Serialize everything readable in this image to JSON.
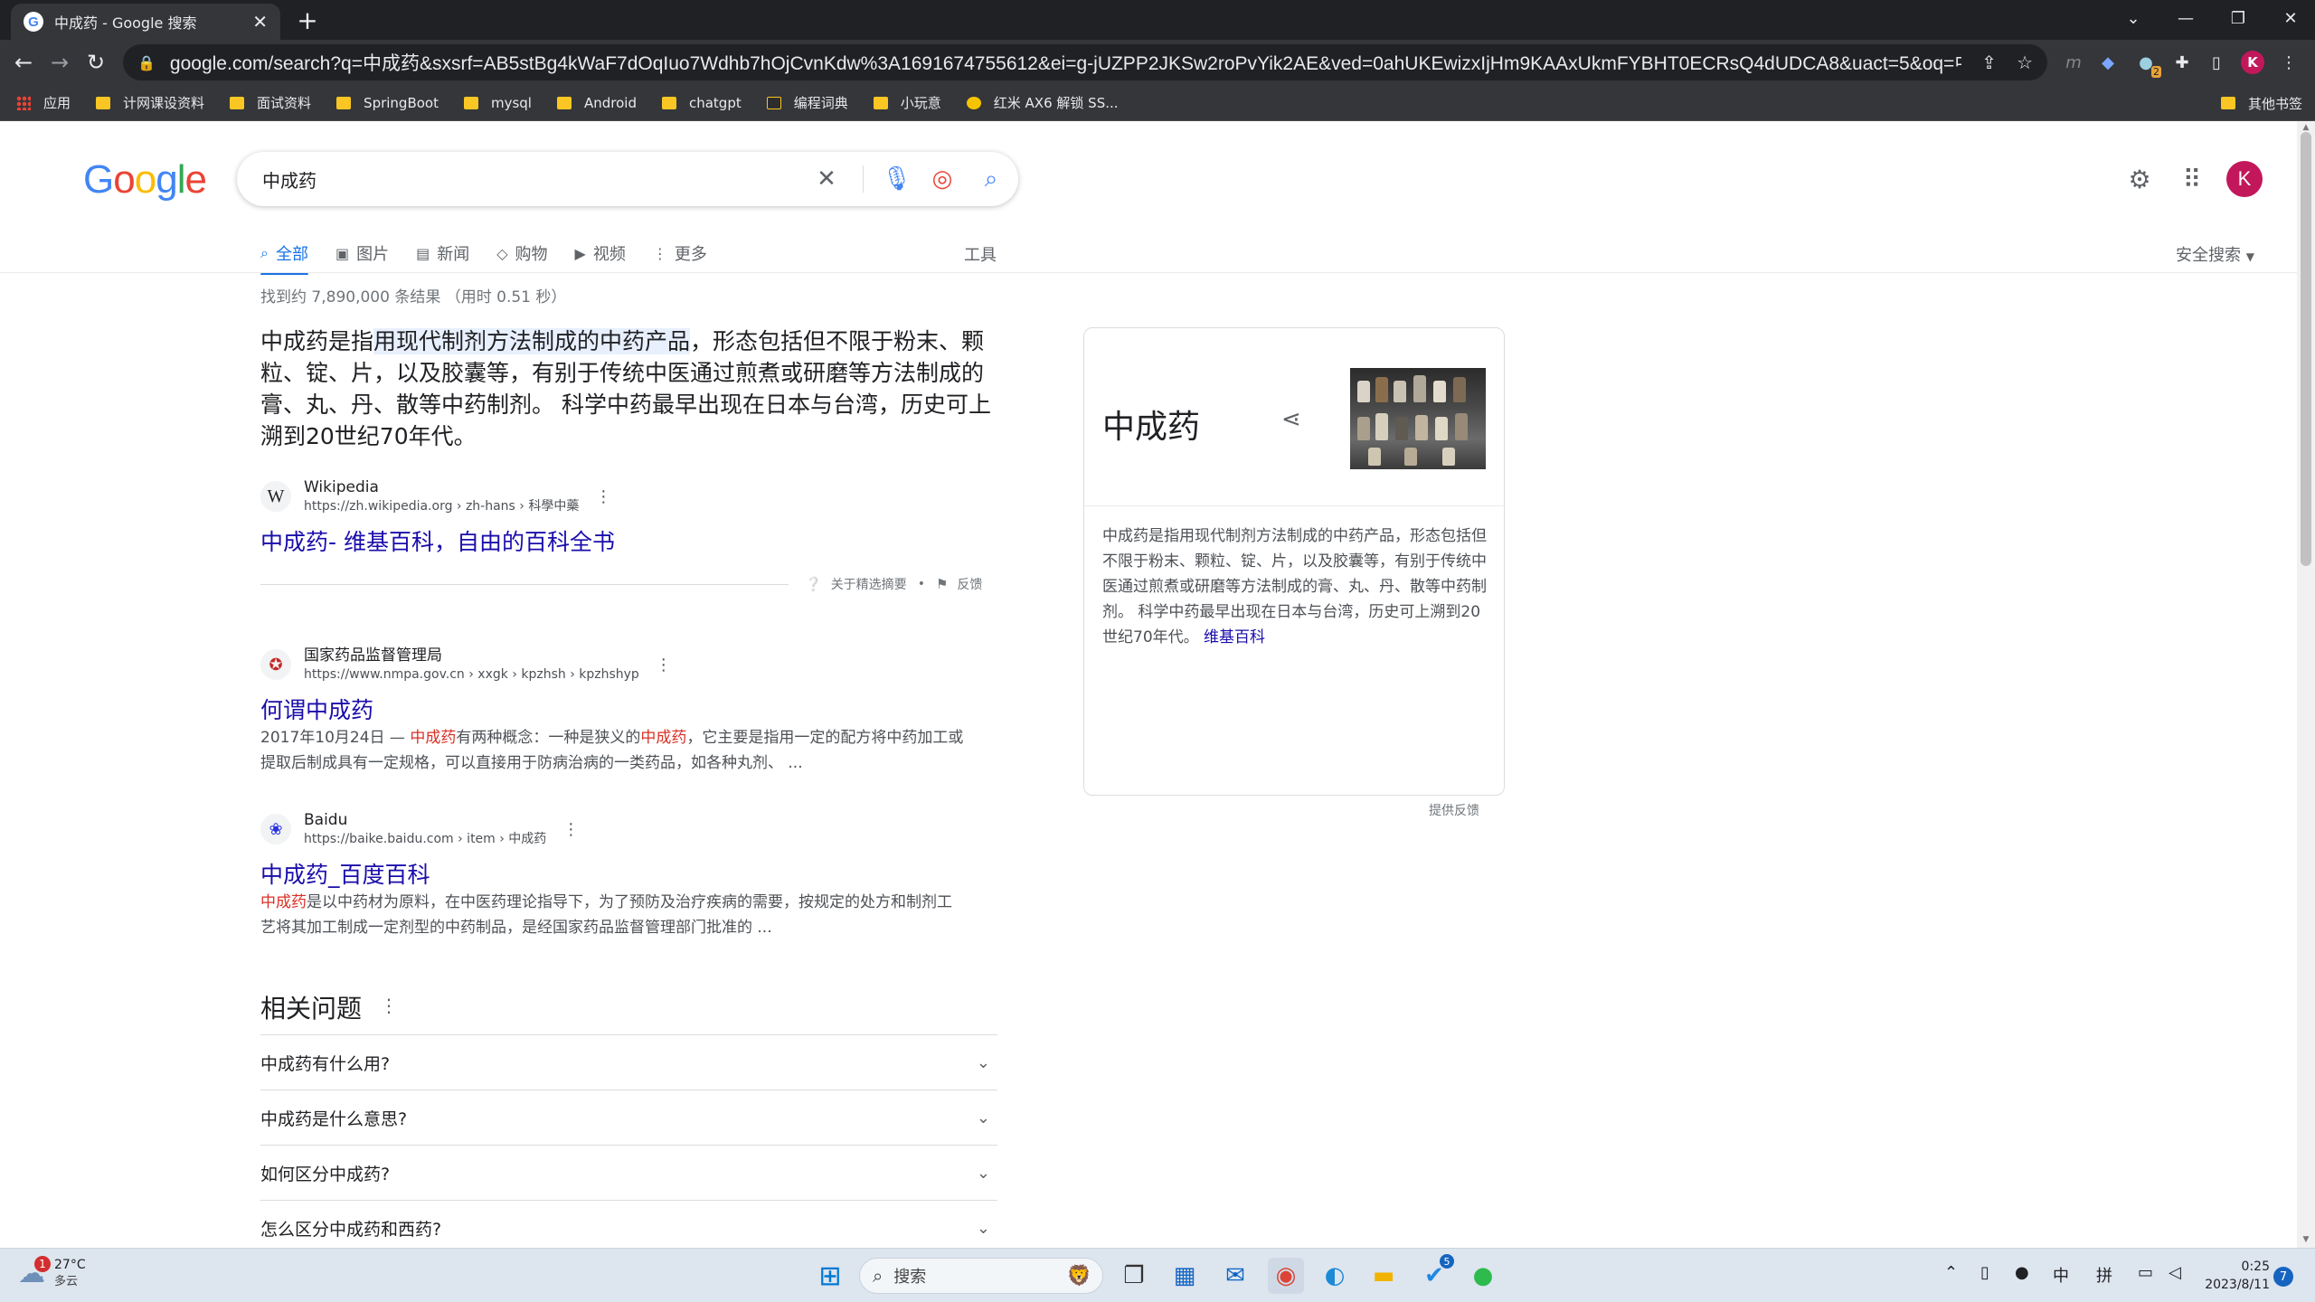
{
  "browser": {
    "tab_title": "中成药 - Google 搜索",
    "tab_close": "✕",
    "new_tab": "+",
    "url": "google.com/search?q=中成药&sxsrf=AB5stBg4kWaF7dOqIuo7Wdhb7hOjCvnKdw%3A1691674755612&ei=g-jUZPP2JKSw2roPvYik2AE&ved=0ahUKEwizxIjHm9KAAxUkmFYBHT0ECRsQ4dUDCA8&uact=5&oq=中成药&gs_lp=Egxnd3Mtd2l6...",
    "profile_initial": "K",
    "ext_badge": "2"
  },
  "bookmarks": {
    "items": [
      {
        "label": "应用",
        "icon": "apps-icon"
      },
      {
        "label": "计网课设资料",
        "icon": "folder-icon"
      },
      {
        "label": "面试资料",
        "icon": "folder-icon"
      },
      {
        "label": "SpringBoot",
        "icon": "folder-icon"
      },
      {
        "label": "mysql",
        "icon": "folder-icon"
      },
      {
        "label": "Android",
        "icon": "folder-icon"
      },
      {
        "label": "chatgpt",
        "icon": "folder-icon"
      },
      {
        "label": "编程词典",
        "icon": "bookmark-icon"
      },
      {
        "label": "小玩意",
        "icon": "folder-icon"
      },
      {
        "label": "红米 AX6 解锁 SS...",
        "icon": "bookmark-icon"
      }
    ],
    "other": "其他书签"
  },
  "search": {
    "query": "中成药",
    "logo": [
      "G",
      "o",
      "o",
      "g",
      "l",
      "e"
    ],
    "logo_colors": [
      "#4285f4",
      "#ea4335",
      "#fbbc05",
      "#4285f4",
      "#34a853",
      "#ea4335"
    ]
  },
  "nav": {
    "tabs": [
      {
        "label": "全部",
        "icon": "search-icon"
      },
      {
        "label": "图片",
        "icon": "image-icon"
      },
      {
        "label": "新闻",
        "icon": "news-icon"
      },
      {
        "label": "购物",
        "icon": "tag-icon"
      },
      {
        "label": "视频",
        "icon": "video-icon"
      },
      {
        "label": "更多",
        "icon": "more-vert-icon"
      }
    ],
    "tools": "工具",
    "safesearch": "安全搜索"
  },
  "stats": "找到约 7,890,000 条结果 （用时 0.51 秒）",
  "featured_snippet": {
    "text_pre": "中成药是指",
    "text_hl": "用现代制剂方法制成的中药产品",
    "text_post": "，形态包括但不限于粉末、颗粒、锭、片，以及胶囊等，有别于传统中医通过煎煮或研磨等方法制成的膏、丸、丹、散等中药制剂。 科学中药最早出现在日本与台湾，历史可上溯到20世纪70年代。",
    "source_name": "Wikipedia",
    "source_url": "https://zh.wikipedia.org › zh-hans › 科學中藥",
    "title": "中成药- 维基百科，自由的百科全书",
    "about": "关于精选摘要",
    "feedback": "反馈"
  },
  "results": [
    {
      "source_name": "国家药品监督管理局",
      "source_url": "https://www.nmpa.gov.cn › xxgk › kpzhsh › kpzhshyp",
      "title": "何谓中成药",
      "desc": [
        {
          "t": "2017年10月24日 — ",
          "em": false
        },
        {
          "t": "中成药",
          "em": true
        },
        {
          "t": "有两种概念：一种是狭义的",
          "em": false
        },
        {
          "t": "中成药",
          "em": true
        },
        {
          "t": "，它主要是指用一定的配方将中药加工或提取后制成具有一定规格，可以直接用于防病治病的一类药品，如各种丸剂、 ...",
          "em": false
        }
      ]
    },
    {
      "source_name": "Baidu",
      "source_url": "https://baike.baidu.com › item › 中成药",
      "title": "中成药_百度百科",
      "desc": [
        {
          "t": "中成药",
          "em": true
        },
        {
          "t": "是以中药材为原料，在中医药理论指导下，为了预防及治疗疾病的需要，按规定的处方和制剂工艺将其加工制成一定剂型的中药制品，是经国家药品监督管理部门批准的 ...",
          "em": false
        }
      ]
    }
  ],
  "paa": {
    "title": "相关问题",
    "questions": [
      "中成药有什么用?",
      "中成药是什么意思?",
      "如何区分中成药?",
      "怎么区分中成药和西药?"
    ]
  },
  "knowledge_panel": {
    "title": "中成药",
    "desc": "中成药是指用现代制剂方法制成的中药产品，形态包括但不限于粉末、颗粒、锭、片，以及胶囊等，有别于传统中医通过煎煮或研磨等方法制成的膏、丸、丹、散等中药制剂。 科学中药最早出现在日本与台湾，历史可上溯到20世纪70年代。",
    "link": "维基百科",
    "feedback": "提供反馈"
  },
  "taskbar": {
    "weather_temp": "27°C",
    "weather_cond": "多云",
    "weather_badge": "1",
    "search_label": "搜索",
    "todo_badge": "5",
    "ime_lang": "中",
    "ime_mode": "拼",
    "time": "0:25",
    "date": "2023/8/11",
    "notif_count": "7"
  }
}
